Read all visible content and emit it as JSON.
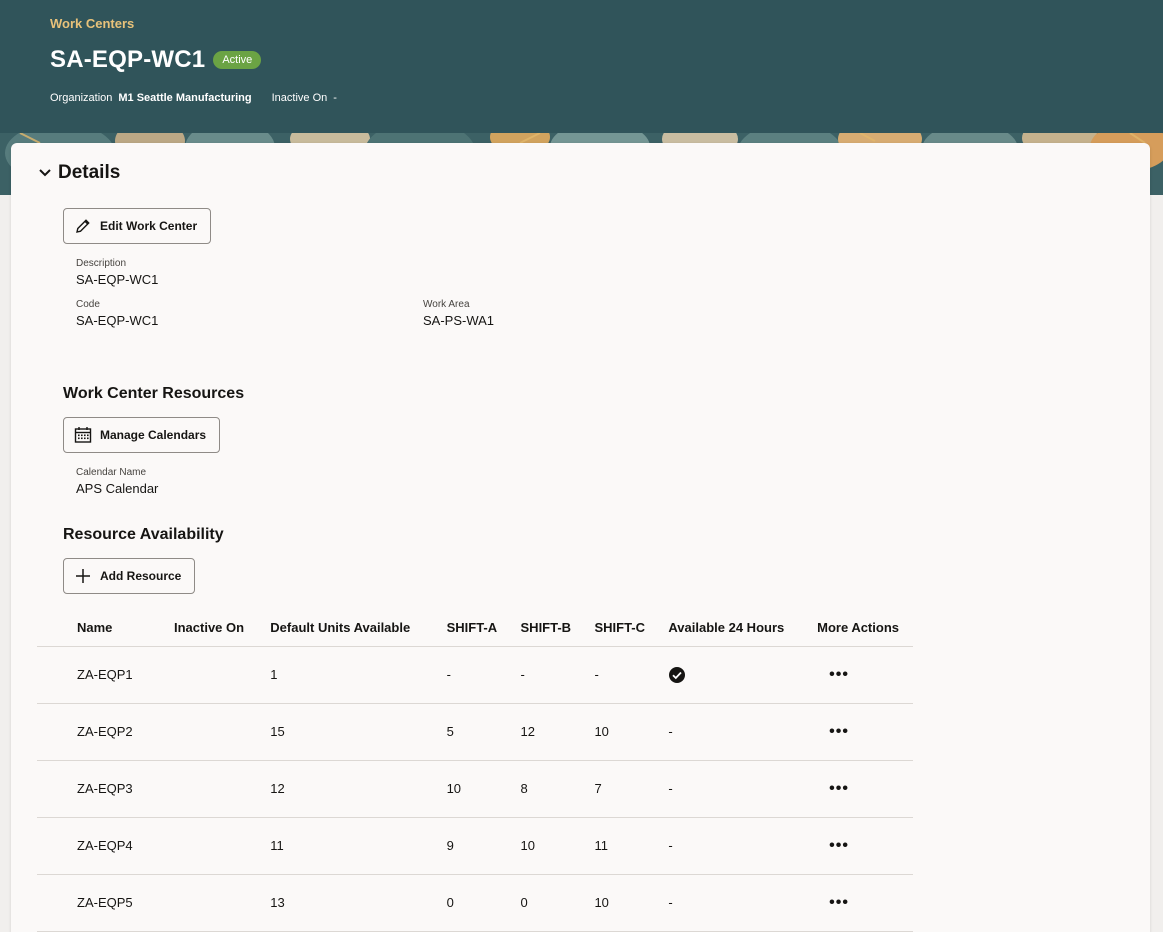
{
  "header": {
    "breadcrumb": "Work Centers",
    "title": "SA-EQP-WC1",
    "status": "Active",
    "organization_label": "Organization",
    "organization_value": "M1 Seattle Manufacturing",
    "inactive_label": "Inactive On",
    "inactive_value": "-"
  },
  "colors": {
    "header_bg": "#30545a",
    "breadcrumb": "#e8c27a",
    "status_badge": "#6ba344"
  },
  "details": {
    "section_title": "Details",
    "edit_button": "Edit Work Center",
    "description_label": "Description",
    "description_value": "SA-EQP-WC1",
    "code_label": "Code",
    "code_value": "SA-EQP-WC1",
    "work_area_label": "Work Area",
    "work_area_value": "SA-PS-WA1"
  },
  "resources": {
    "title": "Work Center Resources",
    "manage_calendars_button": "Manage Calendars",
    "calendar_label": "Calendar Name",
    "calendar_value": "APS Calendar"
  },
  "availability": {
    "title": "Resource Availability",
    "add_button": "Add Resource",
    "columns": [
      "Name",
      "Inactive On",
      "Default Units Available",
      "SHIFT-A",
      "SHIFT-B",
      "SHIFT-C",
      "Available 24 Hours",
      "More Actions"
    ],
    "rows": [
      {
        "name": "ZA-EQP1",
        "inactive": "",
        "units": "1",
        "shift_a": "-",
        "shift_b": "-",
        "shift_c": "-",
        "available_24": "check-icon",
        "more": "•••"
      },
      {
        "name": "ZA-EQP2",
        "inactive": "",
        "units": "15",
        "shift_a": "5",
        "shift_b": "12",
        "shift_c": "10",
        "available_24": "-",
        "more": "•••"
      },
      {
        "name": "ZA-EQP3",
        "inactive": "",
        "units": "12",
        "shift_a": "10",
        "shift_b": "8",
        "shift_c": "7",
        "available_24": "-",
        "more": "•••"
      },
      {
        "name": "ZA-EQP4",
        "inactive": "",
        "units": "11",
        "shift_a": "9",
        "shift_b": "10",
        "shift_c": "11",
        "available_24": "-",
        "more": "•••"
      },
      {
        "name": "ZA-EQP5",
        "inactive": "",
        "units": "13",
        "shift_a": "0",
        "shift_b": "0",
        "shift_c": "10",
        "available_24": "-",
        "more": "•••"
      }
    ]
  },
  "icons": {
    "collapse": "chevron-down-icon",
    "edit": "pencil-icon",
    "calendar": "calendar-icon",
    "add": "plus-icon",
    "check": "check-circle-icon",
    "more": "ellipsis-icon"
  }
}
